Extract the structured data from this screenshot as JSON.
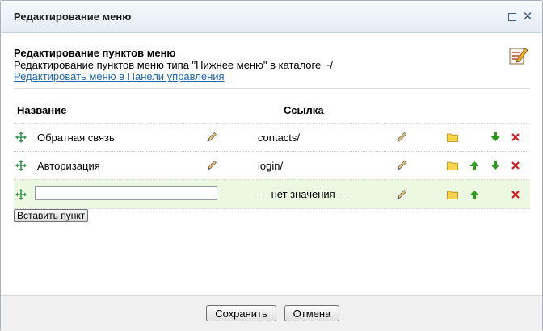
{
  "window": {
    "title": "Редактирование меню"
  },
  "header": {
    "title": "Редактирование пунктов меню",
    "description": "Редактирование пунктов меню типа \"Нижнее меню\" в каталоге ~/",
    "link": "Редактировать меню в Панели управления"
  },
  "table": {
    "columns": {
      "name": "Название",
      "link": "Ссылка"
    },
    "rows": [
      {
        "name": "Обратная связь",
        "link": "contacts/"
      },
      {
        "name": "Авторизация",
        "link": "login/"
      },
      {
        "name": "",
        "link": "--- нет значения ---"
      }
    ]
  },
  "insert_button": "Вставить пункт",
  "footer": {
    "save": "Сохранить",
    "cancel": "Отмена"
  },
  "icons": {
    "move": "move-arrows-icon",
    "edit": "pencil-icon",
    "folder": "folder-icon",
    "up": "arrow-up-icon",
    "down": "arrow-down-icon",
    "delete": "delete-x-icon"
  },
  "colors": {
    "new_row_bg": "#edf8e2",
    "link": "#2067b0",
    "arrow": "#2e9a1e",
    "delete": "#d21a1a"
  }
}
